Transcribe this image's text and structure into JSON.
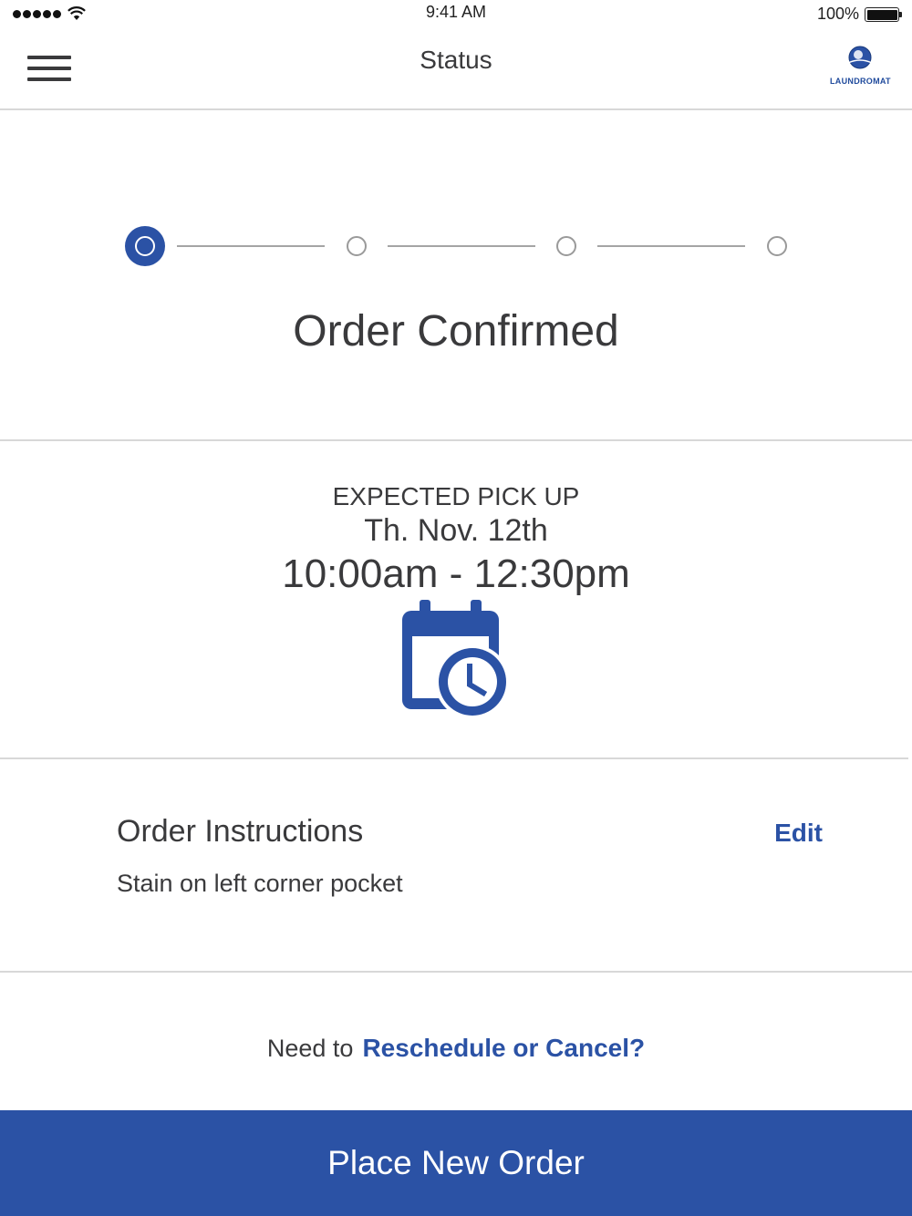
{
  "status_bar": {
    "time": "9:41 AM",
    "battery": "100%"
  },
  "nav": {
    "title": "Status",
    "logo_text": "LAUNDROMAT"
  },
  "progress": {
    "total_steps": 4,
    "current_step": 1,
    "status": "Order Confirmed"
  },
  "pickup": {
    "label": "EXPECTED PICK UP",
    "date": "Th. Nov. 12th",
    "time_window": "10:00am - 12:30pm"
  },
  "instructions": {
    "title": "Order Instructions",
    "edit_label": "Edit",
    "text": "Stain on left corner pocket"
  },
  "reschedule": {
    "prefix": "Need to",
    "link": "Reschedule or Cancel?"
  },
  "cta": {
    "label": "Place New Order"
  },
  "colors": {
    "accent": "#2b52a5",
    "text": "#3a3a3c",
    "divider": "#d8d8d8"
  }
}
